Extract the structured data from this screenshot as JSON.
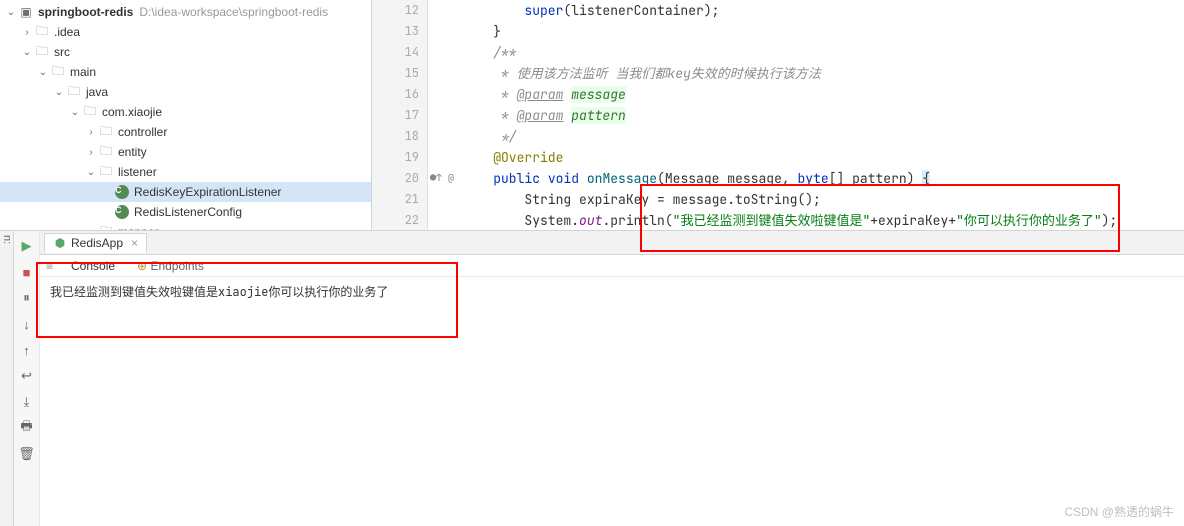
{
  "project": {
    "name": "springboot-redis",
    "path": "D:\\idea-workspace\\springboot-redis",
    "tree": [
      {
        "indent": 0,
        "chev": "down",
        "icon": "module",
        "label": "springboot-redis",
        "bold": true,
        "path": "D:\\idea-workspace\\springboot-redis"
      },
      {
        "indent": 1,
        "chev": "right",
        "icon": "folder",
        "label": ".idea"
      },
      {
        "indent": 1,
        "chev": "down",
        "icon": "folder",
        "label": "src"
      },
      {
        "indent": 2,
        "chev": "down",
        "icon": "folder",
        "label": "main"
      },
      {
        "indent": 3,
        "chev": "down",
        "icon": "folder",
        "label": "java"
      },
      {
        "indent": 4,
        "chev": "down",
        "icon": "package",
        "label": "com.xiaojie"
      },
      {
        "indent": 5,
        "chev": "right",
        "icon": "package",
        "label": "controller"
      },
      {
        "indent": 5,
        "chev": "right",
        "icon": "package",
        "label": "entity"
      },
      {
        "indent": 5,
        "chev": "down",
        "icon": "package",
        "label": "listener"
      },
      {
        "indent": 6,
        "chev": "",
        "icon": "class",
        "label": "RedisKeyExpirationListener",
        "selected": true
      },
      {
        "indent": 6,
        "chev": "",
        "icon": "class",
        "label": "RedisListenerConfig"
      },
      {
        "indent": 5,
        "chev": "right",
        "icon": "package",
        "label": "mapper"
      }
    ]
  },
  "editor": {
    "lines": [
      {
        "num": 12,
        "html": "        <span class='kw'>super</span>(listenerContainer);"
      },
      {
        "num": 13,
        "html": "    }"
      },
      {
        "num": 14,
        "html": "    <span class='comment'>/**</span>"
      },
      {
        "num": 15,
        "html": "<span class='comment'>     * 使用该方法监听 当我们都key失效的时候执行该方法</span>"
      },
      {
        "num": 16,
        "html": "<span class='comment'>     * <span class='doc-tag'>@param</span> <span class='doc-param'>message</span></span>"
      },
      {
        "num": 17,
        "html": "<span class='comment'>     * <span class='doc-tag'>@param</span> <span class='doc-param'>pattern</span></span>"
      },
      {
        "num": 18,
        "html": "<span class='comment'>     */</span>"
      },
      {
        "num": 19,
        "html": "    <span class='annotation'>@Override</span>"
      },
      {
        "num": 20,
        "html": "    <span class='kw'>public</span> <span class='kw'>void</span> <span class='method-name'>onMessage</span>(<span class='type'>Message</span> message, <span class='kw'>byte</span>[] pattern) <span class='brace-hl'>{</span>",
        "mark": "●↑ @"
      },
      {
        "num": 21,
        "html": "        <span class='type'>String</span> expiraKey = message.toString();"
      },
      {
        "num": 22,
        "html": "        <span class='type'>System</span>.<span class='field'>out</span>.println(<span class='str'>\"我已经监测到键值失效啦键值是\"</span>+expiraKey+<span class='str'>\"你可以执行你的业务了\"</span>);"
      }
    ]
  },
  "run": {
    "label_prefix": "n:",
    "tab_name": "RedisApp",
    "sub_tabs": {
      "console": "Console",
      "endpoints": "Endpoints"
    },
    "output": "我已经监测到键值失效啦键值是xiaojie你可以执行你的业务了"
  },
  "watermark": "CSDN @熟透的蜗牛"
}
